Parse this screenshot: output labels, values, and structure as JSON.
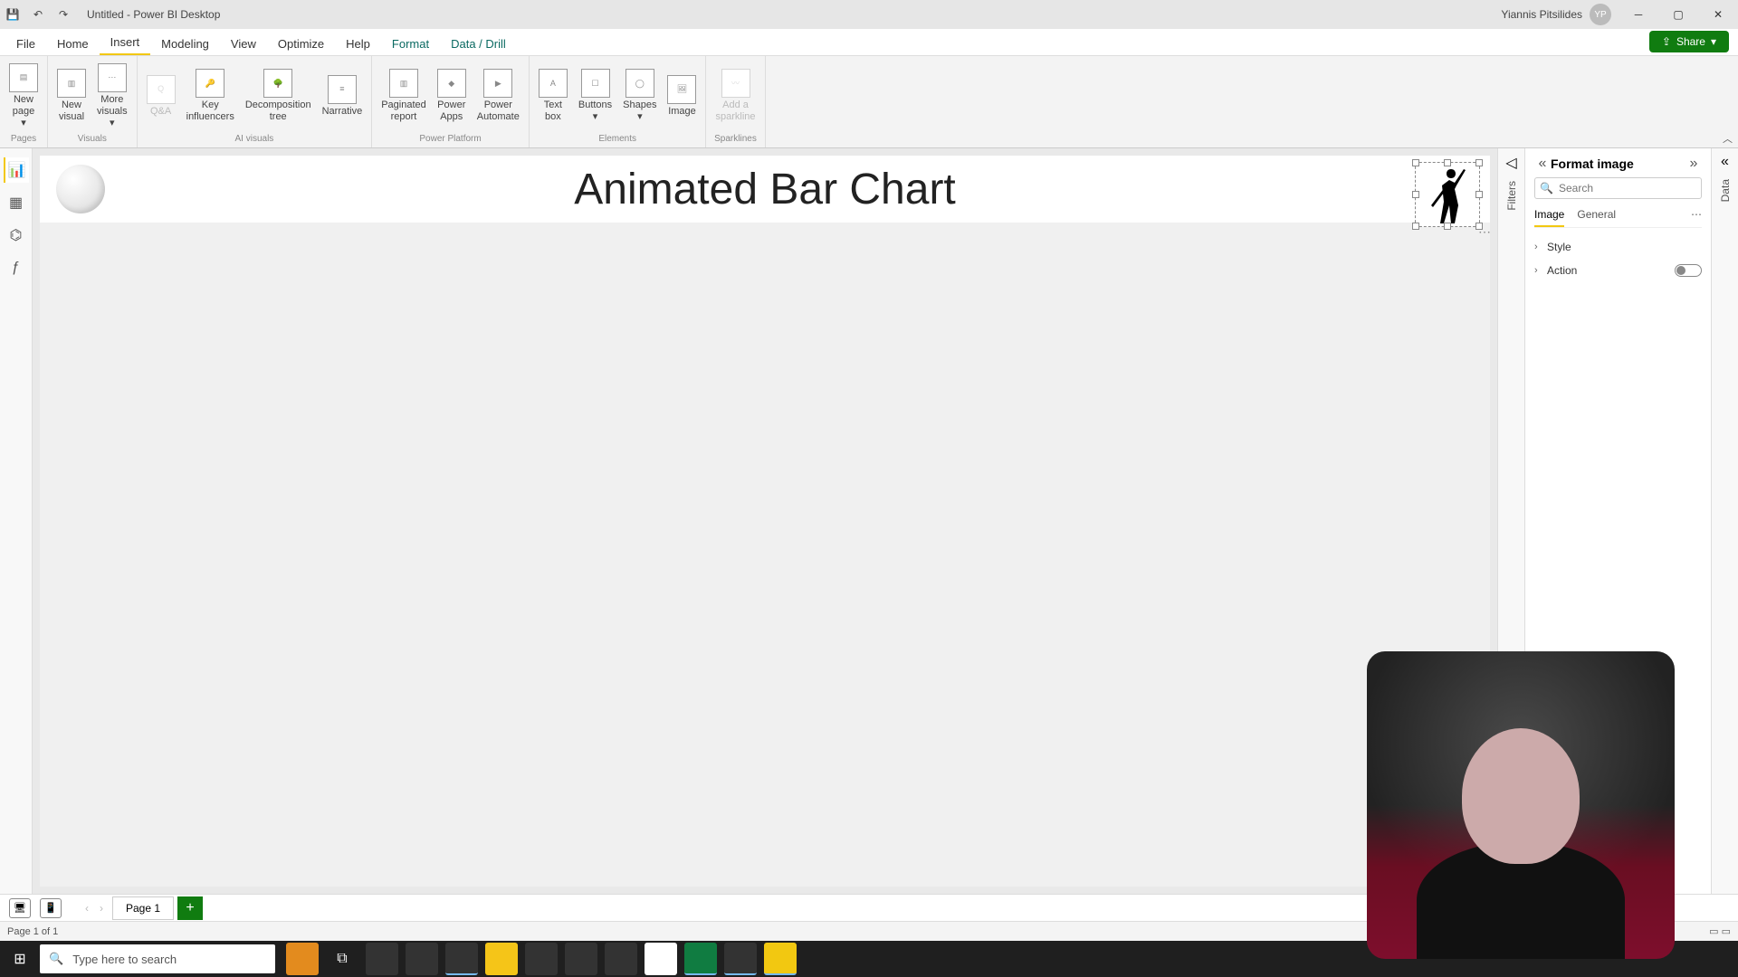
{
  "titlebar": {
    "doc_title": "Untitled - Power BI Desktop",
    "user": "Yiannis Pitsilides"
  },
  "ribbon": {
    "tabs": [
      "File",
      "Home",
      "Insert",
      "Modeling",
      "View",
      "Optimize",
      "Help"
    ],
    "active_tab": "Insert",
    "context_tabs": [
      "Format",
      "Data / Drill"
    ],
    "share": "Share",
    "groups": {
      "pages": {
        "label": "Pages",
        "buttons": [
          {
            "label": "New\npage"
          }
        ]
      },
      "visuals": {
        "label": "Visuals",
        "buttons": [
          {
            "label": "New\nvisual"
          },
          {
            "label": "More\nvisuals"
          }
        ]
      },
      "ai": {
        "label": "AI visuals",
        "buttons": [
          {
            "label": "Q&A",
            "disabled": true
          },
          {
            "label": "Key\ninfluencers"
          },
          {
            "label": "Decomposition\ntree"
          },
          {
            "label": "Narrative"
          }
        ]
      },
      "pp": {
        "label": "Power Platform",
        "buttons": [
          {
            "label": "Paginated\nreport"
          },
          {
            "label": "Power\nApps"
          },
          {
            "label": "Power\nAutomate"
          }
        ]
      },
      "elements": {
        "label": "Elements",
        "buttons": [
          {
            "label": "Text\nbox"
          },
          {
            "label": "Buttons"
          },
          {
            "label": "Shapes"
          },
          {
            "label": "Image"
          }
        ]
      },
      "sparklines": {
        "label": "Sparklines",
        "buttons": [
          {
            "label": "Add a\nsparkline",
            "disabled": true
          }
        ]
      }
    }
  },
  "filters": {
    "label": "Filters"
  },
  "format_pane": {
    "title": "Format image",
    "search_placeholder": "Search",
    "tabs": [
      "Image",
      "General"
    ],
    "active": "Image",
    "sections": [
      {
        "name": "Style",
        "toggle": false
      },
      {
        "name": "Action",
        "toggle": true,
        "on": false
      }
    ]
  },
  "data_pane": {
    "label": "Data"
  },
  "canvas": {
    "title": "Animated Bar Chart"
  },
  "page_tabs": {
    "page": "Page 1"
  },
  "statusbar": {
    "text": "Page 1 of 1"
  },
  "taskbar": {
    "search_placeholder": "Type here to search"
  }
}
